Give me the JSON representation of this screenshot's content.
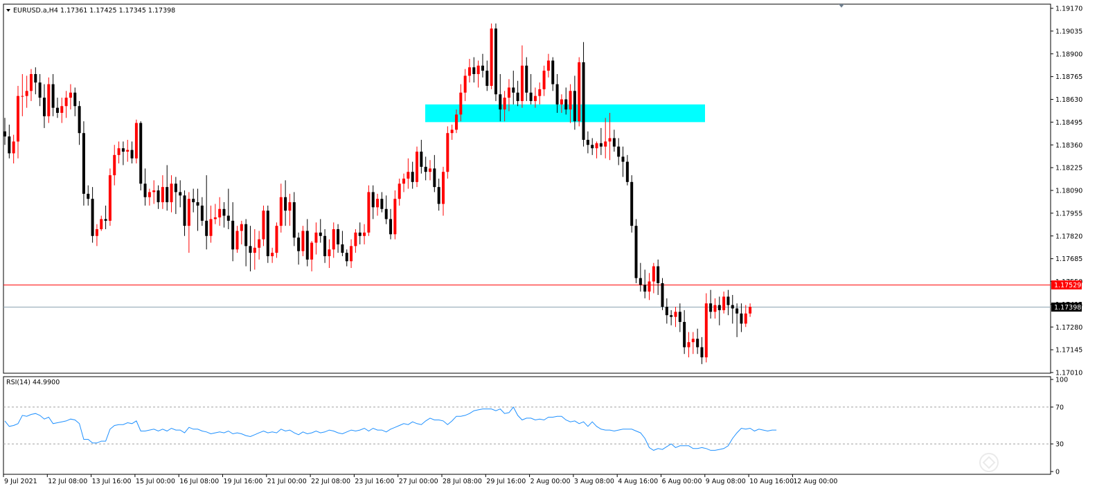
{
  "main_header": {
    "symbol_info": "EURUSD.a,H4",
    "ohlc": "1.17361 1.17425 1.17345 1.17398"
  },
  "rsi_header": {
    "label": "RSI(14) 44.9900"
  },
  "price_tags": {
    "level_line": "1.17529",
    "current": "1.17398"
  },
  "chart_data": [
    {
      "type": "candlestick",
      "symbol": "EURUSD.a",
      "timeframe": "H4",
      "y_tick_labels": [
        "1.19170",
        "1.19035",
        "1.18900",
        "1.18765",
        "1.18630",
        "1.18495",
        "1.18360",
        "1.18225",
        "1.18090",
        "1.17955",
        "1.17820",
        "1.17685",
        "1.17550",
        "1.17415",
        "1.17280",
        "1.17145",
        "1.17010"
      ],
      "x_tick_labels": [
        "9 Jul 2021",
        "12 Jul 08:00",
        "13 Jul 16:00",
        "15 Jul 00:00",
        "16 Jul 08:00",
        "19 Jul 16:00",
        "21 Jul 00:00",
        "22 Jul 08:00",
        "23 Jul 16:00",
        "27 Jul 00:00",
        "28 Jul 08:00",
        "29 Jul 16:00",
        "2 Aug 00:00",
        "3 Aug 08:00",
        "4 Aug 16:00",
        "6 Aug 00:00",
        "9 Aug 08:00",
        "10 Aug 16:00",
        "12 Aug 00:00"
      ],
      "ylim": [
        1.1701,
        1.1917
      ],
      "bull_color": "#ff0000",
      "bear_color": "#000000",
      "zone": {
        "from": 1.18495,
        "to": 1.186,
        "color": "#00ffff"
      },
      "horizontal_lines": [
        {
          "price": 1.17529,
          "color": "#ff0000"
        },
        {
          "price": 1.17398,
          "color": "#8ba2b0"
        }
      ],
      "candles_ohlc": [
        [
          1.1844,
          1.1852,
          1.1836,
          1.1841
        ],
        [
          1.1841,
          1.1848,
          1.1828,
          1.1831
        ],
        [
          1.1831,
          1.1842,
          1.1825,
          1.1838
        ],
        [
          1.1838,
          1.1871,
          1.1828,
          1.1865
        ],
        [
          1.1865,
          1.1878,
          1.1853,
          1.1865
        ],
        [
          1.1865,
          1.1877,
          1.1858,
          1.1868
        ],
        [
          1.1868,
          1.1881,
          1.1862,
          1.1878
        ],
        [
          1.1878,
          1.1882,
          1.1866,
          1.1873
        ],
        [
          1.1873,
          1.1878,
          1.1859,
          1.1864
        ],
        [
          1.1864,
          1.1872,
          1.1846,
          1.1853
        ],
        [
          1.1853,
          1.1876,
          1.1849,
          1.1872
        ],
        [
          1.1872,
          1.1878,
          1.1853,
          1.1858
        ],
        [
          1.1858,
          1.1864,
          1.1852,
          1.1855
        ],
        [
          1.1855,
          1.1864,
          1.1849,
          1.1859
        ],
        [
          1.1859,
          1.1868,
          1.1852,
          1.1864
        ],
        [
          1.1864,
          1.1872,
          1.1857,
          1.1867
        ],
        [
          1.1867,
          1.187,
          1.1853,
          1.1859
        ],
        [
          1.1859,
          1.1862,
          1.1836,
          1.1843
        ],
        [
          1.1843,
          1.185,
          1.18,
          1.1807
        ],
        [
          1.1807,
          1.1812,
          1.18,
          1.1804
        ],
        [
          1.1804,
          1.1811,
          1.1778,
          1.1782
        ],
        [
          1.1782,
          1.1789,
          1.1776,
          1.1786
        ],
        [
          1.1786,
          1.1794,
          1.1785,
          1.1792
        ],
        [
          1.1792,
          1.18,
          1.1786,
          1.1791
        ],
        [
          1.1791,
          1.1822,
          1.1788,
          1.1818
        ],
        [
          1.1818,
          1.1836,
          1.1812,
          1.183
        ],
        [
          1.183,
          1.1838,
          1.1825,
          1.1834
        ],
        [
          1.1834,
          1.1838,
          1.1824,
          1.1832
        ],
        [
          1.1832,
          1.1839,
          1.1826,
          1.1833
        ],
        [
          1.1833,
          1.1838,
          1.1825,
          1.1828
        ],
        [
          1.1828,
          1.1851,
          1.1825,
          1.1849
        ],
        [
          1.1849,
          1.185,
          1.1809,
          1.1813
        ],
        [
          1.1813,
          1.1822,
          1.18,
          1.1805
        ],
        [
          1.1805,
          1.181,
          1.18,
          1.1808
        ],
        [
          1.1808,
          1.1815,
          1.1801,
          1.1809
        ],
        [
          1.1809,
          1.1812,
          1.1798,
          1.1802
        ],
        [
          1.1802,
          1.1818,
          1.1798,
          1.1811
        ],
        [
          1.1811,
          1.1824,
          1.1797,
          1.1802
        ],
        [
          1.1802,
          1.1818,
          1.1796,
          1.1813
        ],
        [
          1.1813,
          1.1817,
          1.1795,
          1.1808
        ],
        [
          1.1808,
          1.1815,
          1.1799,
          1.1806
        ],
        [
          1.1806,
          1.1809,
          1.1782,
          1.1788
        ],
        [
          1.1788,
          1.1808,
          1.1772,
          1.1804
        ],
        [
          1.1804,
          1.181,
          1.1796,
          1.1802
        ],
        [
          1.1802,
          1.181,
          1.1785,
          1.18
        ],
        [
          1.18,
          1.1805,
          1.1788,
          1.1791
        ],
        [
          1.1791,
          1.1818,
          1.1774,
          1.1782
        ],
        [
          1.1782,
          1.18,
          1.1778,
          1.1792
        ],
        [
          1.1792,
          1.1801,
          1.1789,
          1.1793
        ],
        [
          1.1793,
          1.1805,
          1.1788,
          1.1798
        ],
        [
          1.1798,
          1.1802,
          1.1787,
          1.1794
        ],
        [
          1.1794,
          1.181,
          1.1786,
          1.1791
        ],
        [
          1.1791,
          1.1802,
          1.1767,
          1.1774
        ],
        [
          1.1774,
          1.1788,
          1.1772,
          1.1785
        ],
        [
          1.1785,
          1.1791,
          1.1777,
          1.1789
        ],
        [
          1.1789,
          1.1792,
          1.1764,
          1.1776
        ],
        [
          1.1776,
          1.1788,
          1.1761,
          1.1772
        ],
        [
          1.1772,
          1.1786,
          1.1762,
          1.1775
        ],
        [
          1.1775,
          1.1785,
          1.1768,
          1.178
        ],
        [
          1.178,
          1.18,
          1.1776,
          1.1797
        ],
        [
          1.1797,
          1.18,
          1.1766,
          1.177
        ],
        [
          1.177,
          1.1775,
          1.1766,
          1.1772
        ],
        [
          1.1772,
          1.179,
          1.1769,
          1.1788
        ],
        [
          1.1788,
          1.1813,
          1.1784,
          1.1805
        ],
        [
          1.1805,
          1.1815,
          1.1788,
          1.1797
        ],
        [
          1.1797,
          1.1807,
          1.1788,
          1.1802
        ],
        [
          1.1802,
          1.1808,
          1.1776,
          1.1781
        ],
        [
          1.1781,
          1.1784,
          1.1765,
          1.1773
        ],
        [
          1.1773,
          1.1788,
          1.177,
          1.1785
        ],
        [
          1.1785,
          1.1792,
          1.1764,
          1.1768
        ],
        [
          1.1768,
          1.1779,
          1.1761,
          1.1778
        ],
        [
          1.1778,
          1.179,
          1.1771,
          1.1784
        ],
        [
          1.1784,
          1.1792,
          1.1778,
          1.1782
        ],
        [
          1.1782,
          1.1786,
          1.1766,
          1.177
        ],
        [
          1.177,
          1.178,
          1.1763,
          1.1774
        ],
        [
          1.1774,
          1.179,
          1.1769,
          1.1786
        ],
        [
          1.1786,
          1.1789,
          1.1772,
          1.1777
        ],
        [
          1.1777,
          1.1785,
          1.177,
          1.1772
        ],
        [
          1.1772,
          1.1774,
          1.1764,
          1.1767
        ],
        [
          1.1767,
          1.178,
          1.1763,
          1.1776
        ],
        [
          1.1776,
          1.1786,
          1.1772,
          1.1784
        ],
        [
          1.1784,
          1.179,
          1.1777,
          1.1782
        ],
        [
          1.1782,
          1.1789,
          1.1777,
          1.1784
        ],
        [
          1.1784,
          1.1812,
          1.1782,
          1.1808
        ],
        [
          1.1808,
          1.1812,
          1.1792,
          1.1799
        ],
        [
          1.1799,
          1.1807,
          1.1794,
          1.1804
        ],
        [
          1.1804,
          1.1808,
          1.1796,
          1.1798
        ],
        [
          1.1798,
          1.1806,
          1.1789,
          1.1792
        ],
        [
          1.1792,
          1.1798,
          1.178,
          1.1783
        ],
        [
          1.1783,
          1.1809,
          1.178,
          1.1804
        ],
        [
          1.1804,
          1.1816,
          1.18,
          1.1813
        ],
        [
          1.1813,
          1.1819,
          1.1808,
          1.1816
        ],
        [
          1.1816,
          1.1828,
          1.181,
          1.182
        ],
        [
          1.182,
          1.1826,
          1.181,
          1.1814
        ],
        [
          1.1814,
          1.1835,
          1.1811,
          1.1832
        ],
        [
          1.1832,
          1.1839,
          1.1819,
          1.1823
        ],
        [
          1.1823,
          1.1829,
          1.1815,
          1.182
        ],
        [
          1.182,
          1.1827,
          1.1815,
          1.1822
        ],
        [
          1.1822,
          1.183,
          1.1808,
          1.1811
        ],
        [
          1.1811,
          1.1816,
          1.1797,
          1.1801
        ],
        [
          1.1801,
          1.1823,
          1.1794,
          1.182
        ],
        [
          1.182,
          1.1847,
          1.1816,
          1.1843
        ],
        [
          1.1843,
          1.1848,
          1.1839,
          1.1845
        ],
        [
          1.1845,
          1.1857,
          1.1843,
          1.1854
        ],
        [
          1.1854,
          1.1872,
          1.185,
          1.1867
        ],
        [
          1.1867,
          1.1881,
          1.1862,
          1.1877
        ],
        [
          1.1877,
          1.1887,
          1.1873,
          1.1882
        ],
        [
          1.1882,
          1.1888,
          1.1873,
          1.1878
        ],
        [
          1.1878,
          1.1886,
          1.187,
          1.1883
        ],
        [
          1.1883,
          1.189,
          1.1876,
          1.188
        ],
        [
          1.188,
          1.1886,
          1.1868,
          1.1871
        ],
        [
          1.1871,
          1.1908,
          1.1869,
          1.1905
        ],
        [
          1.1905,
          1.1908,
          1.1862,
          1.1866
        ],
        [
          1.1866,
          1.1878,
          1.185,
          1.1857
        ],
        [
          1.1857,
          1.1868,
          1.185,
          1.1864
        ],
        [
          1.1864,
          1.1875,
          1.1856,
          1.187
        ],
        [
          1.187,
          1.188,
          1.186,
          1.1867
        ],
        [
          1.1867,
          1.1874,
          1.1859,
          1.1862
        ],
        [
          1.1862,
          1.1895,
          1.1858,
          1.1883
        ],
        [
          1.1883,
          1.1888,
          1.1862,
          1.1867
        ],
        [
          1.1867,
          1.1878,
          1.186,
          1.1862
        ],
        [
          1.1862,
          1.187,
          1.1858,
          1.1865
        ],
        [
          1.1865,
          1.1873,
          1.186,
          1.1869
        ],
        [
          1.1869,
          1.1883,
          1.1865,
          1.188
        ],
        [
          1.188,
          1.189,
          1.1876,
          1.1886
        ],
        [
          1.1886,
          1.1888,
          1.1868,
          1.1872
        ],
        [
          1.1872,
          1.1878,
          1.1855,
          1.186
        ],
        [
          1.186,
          1.1866,
          1.1855,
          1.1863
        ],
        [
          1.1863,
          1.187,
          1.1854,
          1.1857
        ],
        [
          1.1857,
          1.1872,
          1.1849,
          1.1868
        ],
        [
          1.1868,
          1.1877,
          1.1845,
          1.185
        ],
        [
          1.185,
          1.1888,
          1.1847,
          1.1885
        ],
        [
          1.1885,
          1.1897,
          1.1835,
          1.1839
        ],
        [
          1.1839,
          1.1844,
          1.1831,
          1.1836
        ],
        [
          1.1836,
          1.184,
          1.183,
          1.1834
        ],
        [
          1.1834,
          1.1838,
          1.1828,
          1.1837
        ],
        [
          1.1837,
          1.1846,
          1.183,
          1.1835
        ],
        [
          1.1835,
          1.1852,
          1.1828,
          1.1838
        ],
        [
          1.1838,
          1.1855,
          1.1827,
          1.184
        ],
        [
          1.184,
          1.1845,
          1.1832,
          1.1835
        ],
        [
          1.1835,
          1.184,
          1.1824,
          1.1829
        ],
        [
          1.1829,
          1.1835,
          1.1817,
          1.1826
        ],
        [
          1.1826,
          1.183,
          1.1812,
          1.1814
        ],
        [
          1.1814,
          1.1818,
          1.1784,
          1.1788
        ],
        [
          1.1788,
          1.1792,
          1.1754,
          1.1757
        ],
        [
          1.1757,
          1.1766,
          1.1749,
          1.1753
        ],
        [
          1.1753,
          1.1762,
          1.1745,
          1.1749
        ],
        [
          1.1749,
          1.176,
          1.1744,
          1.1755
        ],
        [
          1.1755,
          1.1766,
          1.1748,
          1.1764
        ],
        [
          1.1764,
          1.1768,
          1.1747,
          1.1754
        ],
        [
          1.1754,
          1.1757,
          1.1738,
          1.174
        ],
        [
          1.174,
          1.1745,
          1.173,
          1.1735
        ],
        [
          1.1735,
          1.1738,
          1.1729,
          1.1734
        ],
        [
          1.1734,
          1.174,
          1.1728,
          1.1737
        ],
        [
          1.1737,
          1.1742,
          1.1725,
          1.1731
        ],
        [
          1.1731,
          1.1738,
          1.1712,
          1.1716
        ],
        [
          1.1716,
          1.1725,
          1.171,
          1.1719
        ],
        [
          1.1719,
          1.1725,
          1.1712,
          1.1721
        ],
        [
          1.1721,
          1.1727,
          1.1712,
          1.1716
        ],
        [
          1.1716,
          1.1722,
          1.1706,
          1.171
        ],
        [
          1.171,
          1.1748,
          1.1707,
          1.1742
        ],
        [
          1.1742,
          1.175,
          1.1733,
          1.1737
        ],
        [
          1.1737,
          1.1745,
          1.1733,
          1.1741
        ],
        [
          1.1741,
          1.1746,
          1.1729,
          1.1738
        ],
        [
          1.1738,
          1.1749,
          1.1736,
          1.1746
        ],
        [
          1.1746,
          1.175,
          1.1735,
          1.1741
        ],
        [
          1.1741,
          1.1747,
          1.173,
          1.1739
        ],
        [
          1.1739,
          1.1742,
          1.1722,
          1.1736
        ],
        [
          1.1736,
          1.1742,
          1.1725,
          1.173
        ],
        [
          1.173,
          1.1741,
          1.1728,
          1.1736
        ],
        [
          1.1736,
          1.1742,
          1.1734,
          1.174
        ]
      ]
    },
    {
      "type": "line",
      "indicator": "RSI(14)",
      "y_tick_labels": [
        "100",
        "70",
        "30",
        "0"
      ],
      "ylim": [
        0,
        100
      ],
      "levels": [
        70,
        30
      ],
      "line_color": "#1e90ff",
      "values": [
        55,
        49,
        50,
        52,
        61,
        60,
        62,
        63,
        61,
        57,
        59,
        52,
        53,
        54,
        55,
        57,
        56,
        52,
        35,
        35,
        31,
        31,
        33,
        33,
        46,
        50,
        51,
        51,
        53,
        52,
        55,
        44,
        44,
        45,
        46,
        44,
        46,
        44,
        47,
        45,
        45,
        42,
        48,
        46,
        46,
        44,
        43,
        41,
        42,
        43,
        42,
        44,
        41,
        42,
        41,
        39,
        38,
        40,
        42,
        44,
        42,
        43,
        42,
        46,
        44,
        45,
        42,
        40,
        43,
        41,
        42,
        44,
        42,
        43,
        45,
        44,
        42,
        41,
        43,
        45,
        44,
        45,
        47,
        44,
        47,
        45,
        45,
        43,
        46,
        48,
        50,
        52,
        51,
        54,
        52,
        51,
        55,
        58,
        56,
        56,
        55,
        51,
        55,
        60,
        60,
        61,
        63,
        66,
        67,
        68,
        68,
        68,
        66,
        68,
        63,
        64,
        70,
        61,
        56,
        58,
        58,
        56,
        57,
        56,
        59,
        59,
        60,
        60,
        56,
        54,
        55,
        52,
        54,
        49,
        54,
        49,
        46,
        45,
        45,
        44,
        45,
        46,
        46,
        46,
        44,
        42,
        36,
        26,
        23,
        25,
        24,
        27,
        30,
        26,
        28,
        28,
        28,
        25,
        25,
        26,
        25,
        23,
        23,
        24,
        25,
        28,
        36,
        42,
        47,
        46,
        47,
        44,
        46,
        45,
        44,
        45,
        45
      ]
    }
  ]
}
